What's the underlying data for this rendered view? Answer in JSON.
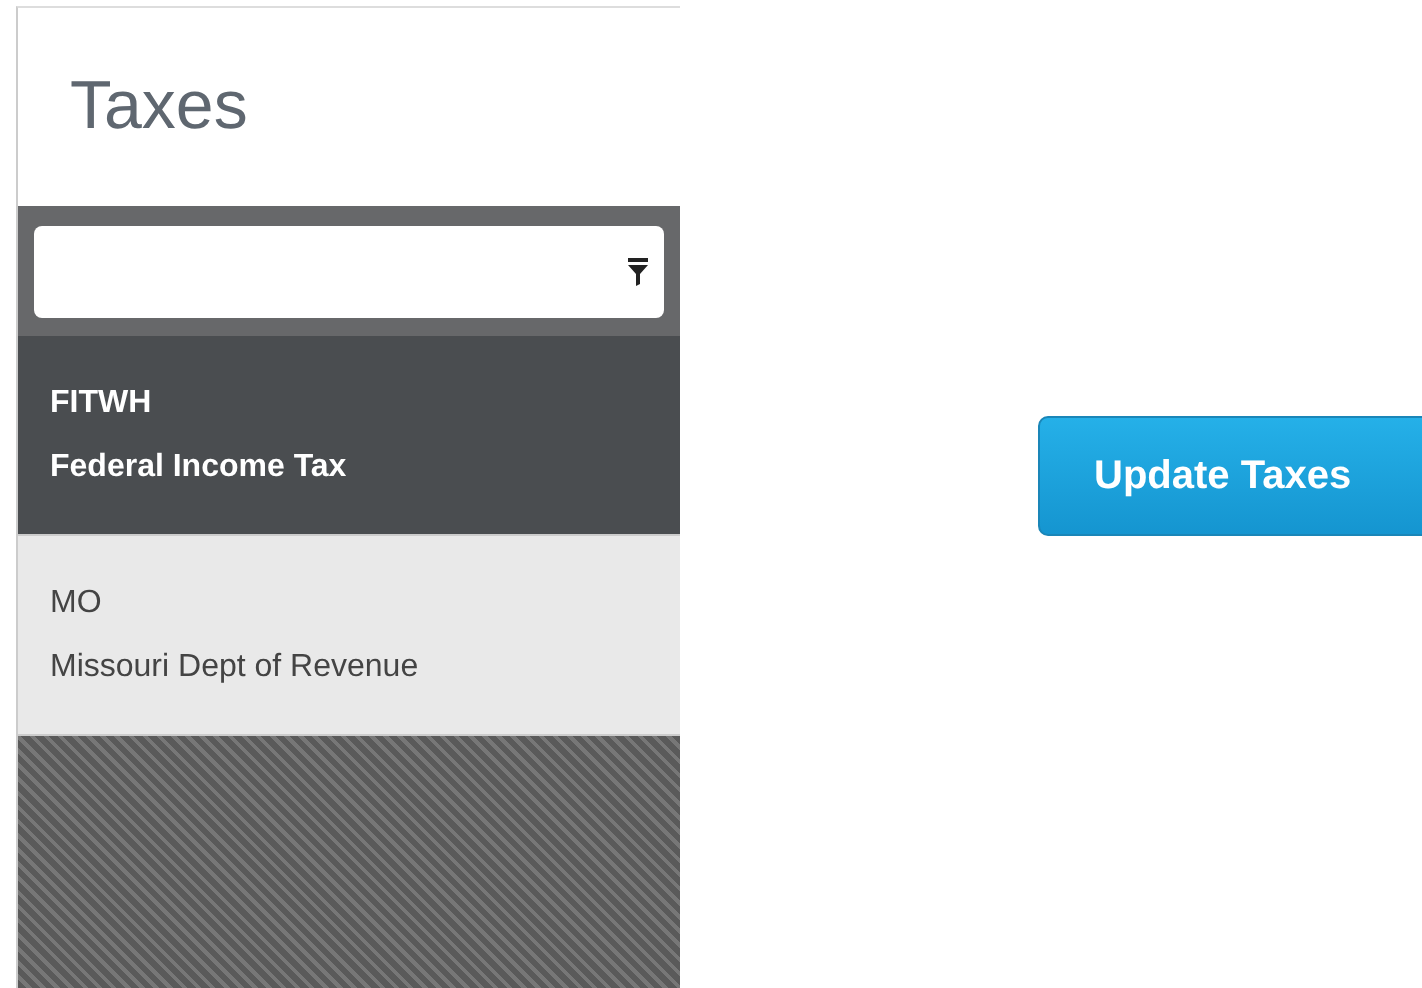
{
  "panel": {
    "title": "Taxes",
    "items": [
      {
        "code": "FITWH",
        "name": "Federal Income Tax",
        "selected": true
      },
      {
        "code": "MO",
        "name": "Missouri Dept of Revenue",
        "selected": false
      }
    ]
  },
  "button": "Update Taxes"
}
